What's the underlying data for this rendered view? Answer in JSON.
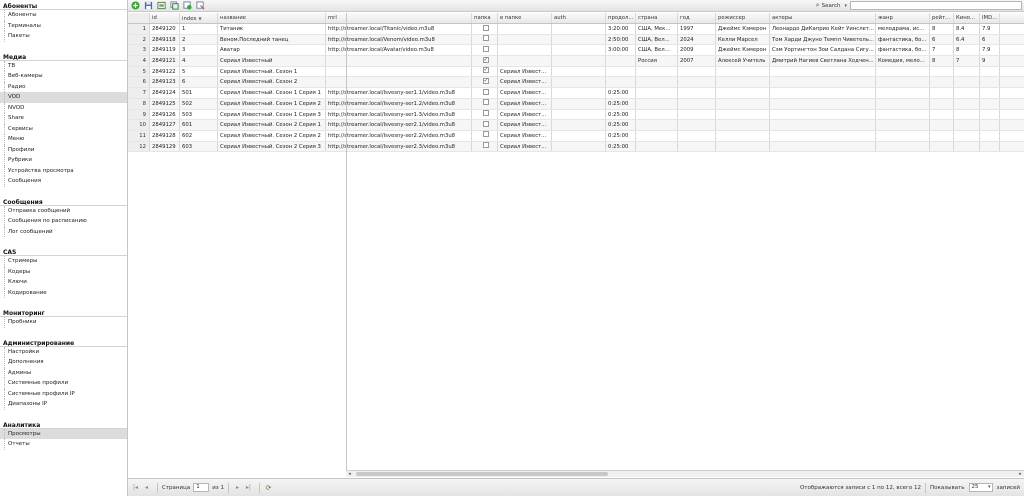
{
  "sidebar": {
    "sections": [
      {
        "title": "Абоненты",
        "items": [
          "Абоненты",
          "Терминалы",
          "Пакеты"
        ]
      },
      {
        "title": "Медиа",
        "items": [
          "ТВ",
          "Веб-камеры",
          "Радио",
          "VOD",
          "NVOD",
          "Share",
          "Сервисы",
          "Меню",
          "Профили",
          "Рубрики",
          "Устройства просмотра",
          "Сообщения"
        ]
      },
      {
        "title": "Сообщения",
        "items": [
          "Отправка сообщений",
          "Сообщения по расписанию",
          "Лог сообщений"
        ]
      },
      {
        "title": "CAS",
        "items": [
          "Стримеры",
          "Кодеры",
          "Ключи",
          "Кодирование"
        ]
      },
      {
        "title": "Мониторинг",
        "items": [
          "Пробники"
        ]
      },
      {
        "title": "Администрирование",
        "items": [
          "Настройки",
          "Дополнения",
          "Админы",
          "Системные профили",
          "Системные профили IP",
          "Диапазоны IP"
        ]
      },
      {
        "title": "Аналитика",
        "items": [
          "Просмотры",
          "Отчеты"
        ]
      }
    ],
    "selected": [
      "VOD",
      "Просмотры"
    ]
  },
  "toolbar": {
    "buttons": [
      "add-icon",
      "save-icon",
      "export-icon",
      "copy-icon",
      "refresh-icon",
      "settings-icon"
    ],
    "search_label": "Search",
    "search_value": ""
  },
  "grid": {
    "columns": [
      "id",
      "index",
      "название",
      "mrl",
      "папка",
      "в папке",
      "auth",
      "продол...",
      "страна",
      "год",
      "режиссер",
      "актеры",
      "жанр",
      "рейт...",
      "Кино...",
      "IMDB..."
    ],
    "rows": [
      {
        "n": "1",
        "id": "2849120",
        "index": "1",
        "name": "Титаник",
        "mrl": "http://streamer.local/Titanic/video.m3u8",
        "folder": false,
        "in_folder": "",
        "auth": "",
        "dur": "3:20:00",
        "country": "США, Мек...",
        "year": "1997",
        "director": "Джеймс Кэмерон",
        "actors": "Леонардо ДиКаприо Кейт Уинслет...",
        "genre": "мелодрама, ис...",
        "rating": "8",
        "kino": "8.4",
        "imdb": "7.9"
      },
      {
        "n": "2",
        "id": "2849118",
        "index": "2",
        "name": "Веном.Последний танец",
        "mrl": "http://streamer.local/Venom/video.m3u8",
        "folder": false,
        "in_folder": "",
        "auth": "",
        "dur": "2:50:00",
        "country": "США, Вел...",
        "year": "2024",
        "director": "Келли Марсел",
        "actors": "Том Харди Джуно Темпл Чиветель...",
        "genre": "фантастика, бо...",
        "rating": "6",
        "kino": "6.4",
        "imdb": "6"
      },
      {
        "n": "3",
        "id": "2849119",
        "index": "3",
        "name": "Аватар",
        "mrl": "http://streamer.local/Avatar/video.m3u8",
        "folder": false,
        "in_folder": "",
        "auth": "",
        "dur": "3:00:00",
        "country": "США, Вел...",
        "year": "2009",
        "director": "Джеймс Кэмерон",
        "actors": "Сэм Уортингтон Зои Салдана Сигу...",
        "genre": "фантастика, бо...",
        "rating": "7",
        "kino": "8",
        "imdb": "7.9"
      },
      {
        "n": "4",
        "id": "2849121",
        "index": "4",
        "name": "Сериал Известный",
        "mrl": "",
        "folder": true,
        "in_folder": "",
        "auth": "",
        "dur": "",
        "country": "Россия",
        "year": "2007",
        "director": "Алексей Учитель",
        "actors": "Дмитрий Нагиев Светлана Ходчен...",
        "genre": "Комедия, мело...",
        "rating": "8",
        "kino": "7",
        "imdb": "9"
      },
      {
        "n": "5",
        "id": "2849122",
        "index": "5",
        "name": "Сериал Известный. Сезон 1",
        "mrl": "",
        "folder": true,
        "in_folder": "Сериал Извест...",
        "auth": "",
        "dur": "",
        "country": "",
        "year": "",
        "director": "",
        "actors": "",
        "genre": "",
        "rating": "",
        "kino": "",
        "imdb": ""
      },
      {
        "n": "6",
        "id": "2849123",
        "index": "6",
        "name": "Сериал Известный. Сезон 2",
        "mrl": "",
        "folder": true,
        "in_folder": "Сериал Извест...",
        "auth": "",
        "dur": "",
        "country": "",
        "year": "",
        "director": "",
        "actors": "",
        "genre": "",
        "rating": "",
        "kino": "",
        "imdb": ""
      },
      {
        "n": "7",
        "id": "2849124",
        "index": "501",
        "name": "Сериал Известный. Сезон 1 Серия 1",
        "mrl": "http://streamer.local/Isvesny-ser1.1/video.m3u8",
        "folder": false,
        "in_folder": "Сериал Извест...",
        "auth": "",
        "dur": "0:25:00",
        "country": "",
        "year": "",
        "director": "",
        "actors": "",
        "genre": "",
        "rating": "",
        "kino": "",
        "imdb": ""
      },
      {
        "n": "8",
        "id": "2849125",
        "index": "502",
        "name": "Сериал Известный. Сезон 1 Серия 2",
        "mrl": "http://streamer.local/Isvesny-ser1.2/video.m3u8",
        "folder": false,
        "in_folder": "Сериал Извест...",
        "auth": "",
        "dur": "0:25:00",
        "country": "",
        "year": "",
        "director": "",
        "actors": "",
        "genre": "",
        "rating": "",
        "kino": "",
        "imdb": ""
      },
      {
        "n": "9",
        "id": "2849126",
        "index": "503",
        "name": "Сериал Известный. Сезон 1 Серия 3",
        "mrl": "http://streamer.local/Isvesny-ser1.3/video.m3u8",
        "folder": false,
        "in_folder": "Сериал Извест...",
        "auth": "",
        "dur": "0:25:00",
        "country": "",
        "year": "",
        "director": "",
        "actors": "",
        "genre": "",
        "rating": "",
        "kino": "",
        "imdb": ""
      },
      {
        "n": "10",
        "id": "2849127",
        "index": "601",
        "name": "Сериал Известный. Сезон 2 Серия 1",
        "mrl": "http://streamer.local/Isvesny-ser2.1/video.m3u8",
        "folder": false,
        "in_folder": "Сериал Извест...",
        "auth": "",
        "dur": "0:25:00",
        "country": "",
        "year": "",
        "director": "",
        "actors": "",
        "genre": "",
        "rating": "",
        "kino": "",
        "imdb": ""
      },
      {
        "n": "11",
        "id": "2849128",
        "index": "602",
        "name": "Сериал Известный. Сезон 2 Серия 2",
        "mrl": "http://streamer.local/Isvesny-ser2.2/video.m3u8",
        "folder": false,
        "in_folder": "Сериал Извест...",
        "auth": "",
        "dur": "0:25:00",
        "country": "",
        "year": "",
        "director": "",
        "actors": "",
        "genre": "",
        "rating": "",
        "kino": "",
        "imdb": ""
      },
      {
        "n": "12",
        "id": "2849129",
        "index": "603",
        "name": "Сериал Известный. Сезон 2 Серия 3",
        "mrl": "http://streamer.local/Isvesny-ser2.3/video.m3u8",
        "folder": false,
        "in_folder": "Сериал Извест...",
        "auth": "",
        "dur": "0:25:00",
        "country": "",
        "year": "",
        "director": "",
        "actors": "",
        "genre": "",
        "rating": "",
        "kino": "",
        "imdb": ""
      }
    ]
  },
  "pager": {
    "page_label": "Страница",
    "page_value": "1",
    "of_label": "из 1",
    "summary": "Отображаются записи с 1 по 12, всего 12",
    "show_label": "Показывать",
    "page_size": "25",
    "records_label": "записей"
  }
}
